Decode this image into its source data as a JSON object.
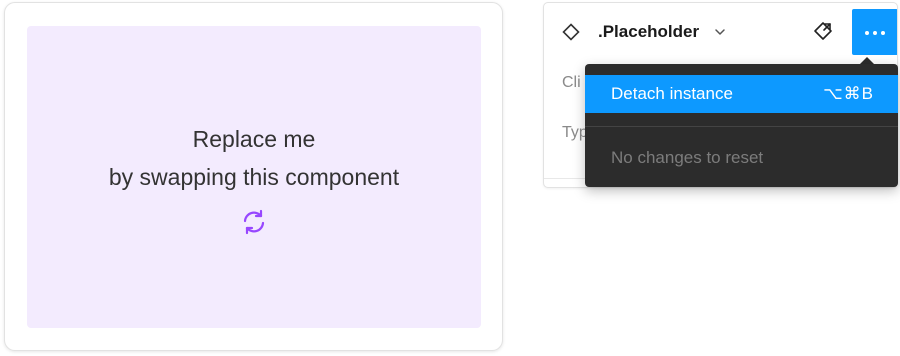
{
  "placeholder": {
    "line1": "Replace me",
    "line2": "by swapping this component",
    "icon": "swap-icon",
    "background": "#f3ebfe",
    "icon_color": "#9747ff"
  },
  "panel": {
    "component_name": ".Placeholder",
    "icons": [
      "component-icon",
      "chevron-down-icon",
      "go-to-main-component-icon",
      "more-options-icon"
    ],
    "truncated_labels": [
      "Cli",
      "Typ"
    ],
    "accent": "#0d99ff"
  },
  "menu": {
    "items": [
      {
        "label": "Detach instance",
        "shortcut": "⌥⌘B",
        "state": "highlighted"
      },
      {
        "label": "No changes to reset",
        "state": "disabled"
      }
    ],
    "background": "#2c2c2c"
  }
}
